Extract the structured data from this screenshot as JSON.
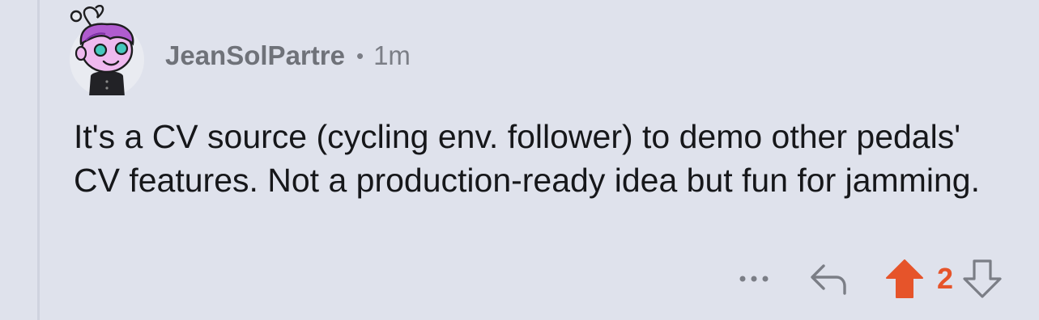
{
  "comment": {
    "username": "JeanSolPartre",
    "separator": "•",
    "time": "1m",
    "body": "It's a CV source (cycling env. follower) to demo other pedals' CV features. Not a production-ready idea but fun for jamming.",
    "score": "2",
    "vote_state": "upvoted"
  },
  "icons": {
    "avatar": "snoo-avatar",
    "more": "ellipsis-icon",
    "reply": "reply-icon",
    "upvote": "upvote-arrow-icon",
    "downvote": "downvote-arrow-icon"
  },
  "colors": {
    "background": "#dfe2ec",
    "upvote_active": "#e6542a",
    "text": "#16171a",
    "meta": "#7b7e86"
  }
}
